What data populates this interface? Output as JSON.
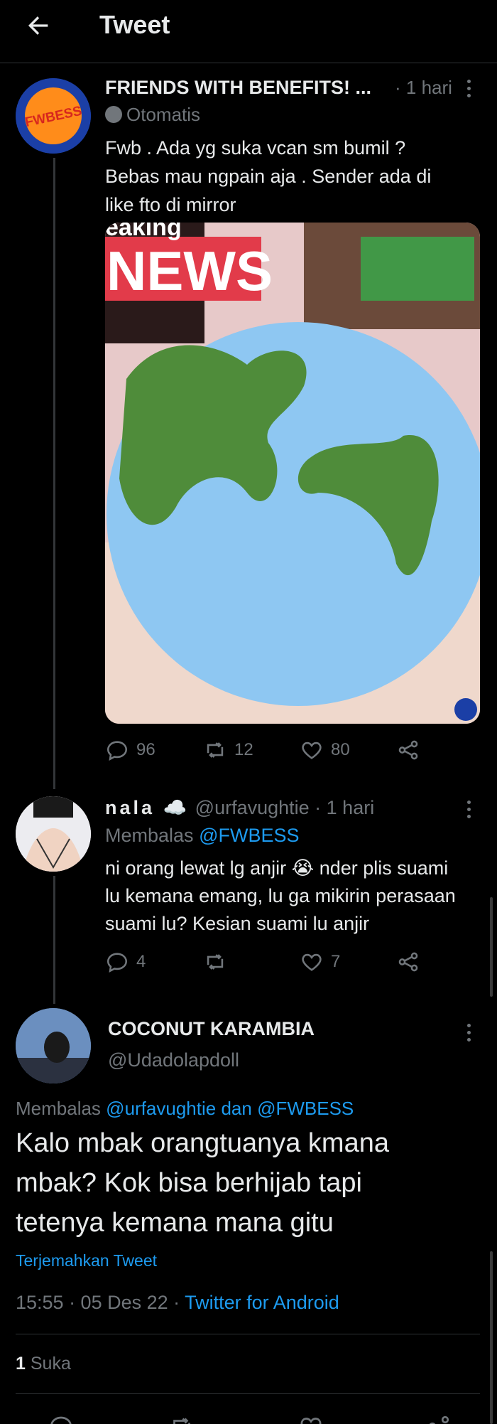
{
  "header": {
    "title": "Tweet",
    "back_icon": "arrow-left-icon"
  },
  "tweet1": {
    "name": "FRIENDS WITH BENEFITS! ...",
    "time": "· 1 hari",
    "automated": "Otomatis",
    "text_lines": [
      "Fwb . Ada yg suka vcan sm bumil ?",
      "Bebas mau ngpain aja . Sender ada di",
      "like fto di mirror"
    ],
    "media_banner": "NEWS",
    "media_banner_top": "eaking",
    "avatar_text": "FWBESS",
    "replies": "96",
    "retweets": "12",
    "likes": "80"
  },
  "tweet2": {
    "name": "nala ☁️",
    "handle": "@urfavughtie · 1 hari",
    "reply_prefix": "Membalas",
    "reply_to": "@FWBESS",
    "text_lines": [
      "ni orang lewat lg anjir 😭 nder plis suami",
      "lu kemana emang, lu ga mikirin perasaan",
      "suami lu? Kesian suami lu anjir"
    ],
    "replies": "4",
    "retweets": "",
    "likes": "7"
  },
  "tweet3": {
    "name": "COCONUT KARAMBIA",
    "handle": "@Udadolapdoll",
    "reply_prefix": "Membalas",
    "reply_to_1": "@urfavughtie",
    "reply_and": "dan",
    "reply_to_2": "@FWBESS",
    "text_lines": [
      "Kalo mbak orangtuanya kmana",
      "mbak? Kok bisa berhijab tapi",
      "tetenya kemana mana gitu"
    ],
    "translate": "Terjemahkan Tweet",
    "time": "15:55 · 05 Des 22 ·",
    "source": "Twitter for Android",
    "likes_count": "1",
    "likes_label": "Suka"
  },
  "colors": {
    "accent": "#1d9bf0",
    "background": "#000000",
    "muted": "#71767b"
  }
}
